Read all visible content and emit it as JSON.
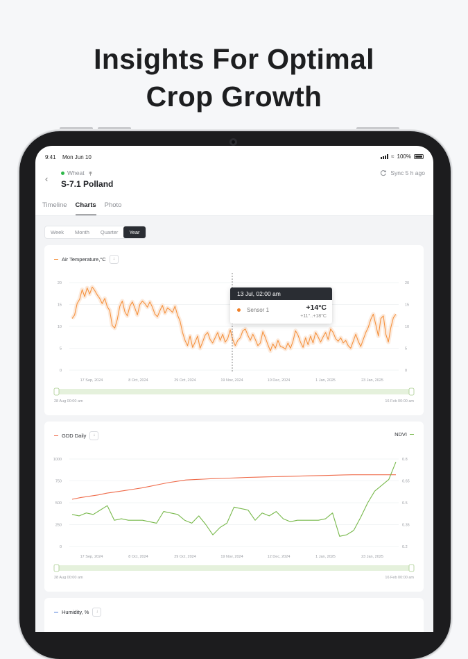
{
  "headline": {
    "line1": "Insights For Optimal",
    "line2": "Crop Growth"
  },
  "status_bar": {
    "time": "9:41",
    "date": "Mon Jun 10",
    "battery": "100%"
  },
  "header": {
    "back_icon": "chevron-left-icon",
    "crop": "Wheat",
    "field_name": "S-7.1 Polland",
    "sync": "Sync 5 h ago"
  },
  "tabs": [
    {
      "label": "Timeline",
      "active": false
    },
    {
      "label": "Charts",
      "active": true
    },
    {
      "label": "Photo",
      "active": false
    }
  ],
  "period": [
    {
      "label": "Week",
      "selected": false
    },
    {
      "label": "Month",
      "selected": false
    },
    {
      "label": "Quarter",
      "selected": false
    },
    {
      "label": "Year",
      "selected": true
    }
  ],
  "colors": {
    "temperature": "#f5923e",
    "gdd": "#ef6b4a",
    "ndvi": "#77b84a",
    "humidity": "#4b7bd8",
    "range_band": "#e5f1dc"
  },
  "chart_data": [
    {
      "type": "line",
      "title": "Air Temperature,°C",
      "x_ticks": [
        "17 Sep, 2024",
        "8 Oct, 2024",
        "29 Oct, 2024",
        "19 Nov, 2024",
        "10 Dec, 2024",
        "1 Jan, 2025",
        "23 Jan, 2025"
      ],
      "y_ticks": [
        "20",
        "15",
        "10",
        "5",
        "0"
      ],
      "ylim": [
        0,
        20
      ],
      "range_start": "28 Aug 00:00 am",
      "range_end": "16 Feb 00:00 am",
      "series": [
        {
          "name": "Sensor 1",
          "values": [
            11.8,
            12.6,
            15.2,
            16.2,
            18.4,
            16.8,
            18.8,
            17.4,
            19.0,
            18.2,
            17.2,
            16.4,
            15.2,
            16.4,
            14.5,
            13.6,
            10.2,
            9.6,
            11.6,
            14.6,
            15.8,
            13.4,
            12.4,
            14.6,
            15.6,
            14.2,
            12.6,
            15.0,
            15.8,
            15.2,
            14.4,
            15.6,
            14.4,
            12.8,
            12.2,
            13.6,
            14.8,
            13.0,
            14.2,
            13.8,
            13.2,
            14.6,
            12.6,
            11.2,
            8.6,
            6.8,
            5.6,
            7.8,
            5.2,
            6.4,
            7.8,
            5.0,
            6.4,
            8.0,
            8.6,
            7.0,
            6.2,
            7.4,
            8.6,
            6.8,
            8.2,
            6.4,
            7.2,
            9.2,
            7.0,
            5.6,
            6.8,
            7.4,
            9.0,
            9.4,
            8.0,
            6.8,
            8.2,
            7.0,
            5.6,
            6.2,
            8.8,
            7.4,
            5.8,
            4.4,
            6.0,
            5.0,
            6.8,
            5.4,
            5.2,
            4.8,
            6.2,
            5.0,
            6.6,
            9.0,
            8.0,
            6.4,
            5.2,
            7.4,
            5.8,
            7.8,
            6.2,
            8.6,
            7.6,
            6.4,
            7.6,
            8.6,
            7.0,
            9.4,
            8.6,
            7.2,
            6.6,
            7.4,
            6.2,
            6.8,
            5.6,
            5.0,
            6.6,
            8.2,
            6.6,
            5.4,
            7.0,
            8.6,
            9.8,
            11.6,
            12.8,
            10.4,
            7.8,
            11.8,
            12.4,
            8.2,
            6.4,
            9.8,
            12.0,
            12.8
          ]
        }
      ],
      "tooltip": {
        "date": "13 Jul, 02:00 am",
        "series": "Sensor 1",
        "value": "+14°C",
        "range": "+11°..+18°C"
      }
    },
    {
      "type": "line",
      "title": "GDD Daily",
      "right_title": "NDVI",
      "x_ticks": [
        "17 Sep, 2024",
        "8 Oct, 2024",
        "29 Oct, 2024",
        "19 Nov, 2024",
        "12 Dec, 2024",
        "1 Jan, 2025",
        "23 Jan, 2025"
      ],
      "y_ticks_left": [
        "1000",
        "750",
        "500",
        "250",
        "0"
      ],
      "y_ticks_right": [
        "0.8",
        "0.65",
        "0.5",
        "0.35",
        "0.2"
      ],
      "ylim_left": [
        0,
        1000
      ],
      "ylim_right": [
        0.2,
        0.8
      ],
      "range_start": "28 Aug 00:00 am",
      "range_end": "16 Feb 00:00 am",
      "series": [
        {
          "name": "GDD Daily",
          "axis": "left",
          "values": [
            540,
            560,
            575,
            590,
            610,
            625,
            640,
            655,
            670,
            690,
            710,
            730,
            745,
            760,
            765,
            770,
            775,
            778,
            782,
            785,
            790,
            792,
            795,
            798,
            800,
            802,
            805,
            808,
            810,
            812,
            815,
            818,
            820,
            820,
            820,
            820,
            820,
            820
          ]
        },
        {
          "name": "NDVI",
          "axis": "right",
          "values": [
            0.42,
            0.41,
            0.43,
            0.42,
            0.45,
            0.48,
            0.38,
            0.39,
            0.38,
            0.38,
            0.38,
            0.37,
            0.36,
            0.44,
            0.43,
            0.42,
            0.38,
            0.36,
            0.41,
            0.35,
            0.28,
            0.33,
            0.36,
            0.47,
            0.46,
            0.45,
            0.38,
            0.43,
            0.41,
            0.44,
            0.39,
            0.37,
            0.38,
            0.38,
            0.38,
            0.38,
            0.39,
            0.43,
            0.27,
            0.28,
            0.31,
            0.4,
            0.5,
            0.58,
            0.62,
            0.66,
            0.78
          ]
        }
      ]
    }
  ],
  "humidity_title": "Humidity, %"
}
